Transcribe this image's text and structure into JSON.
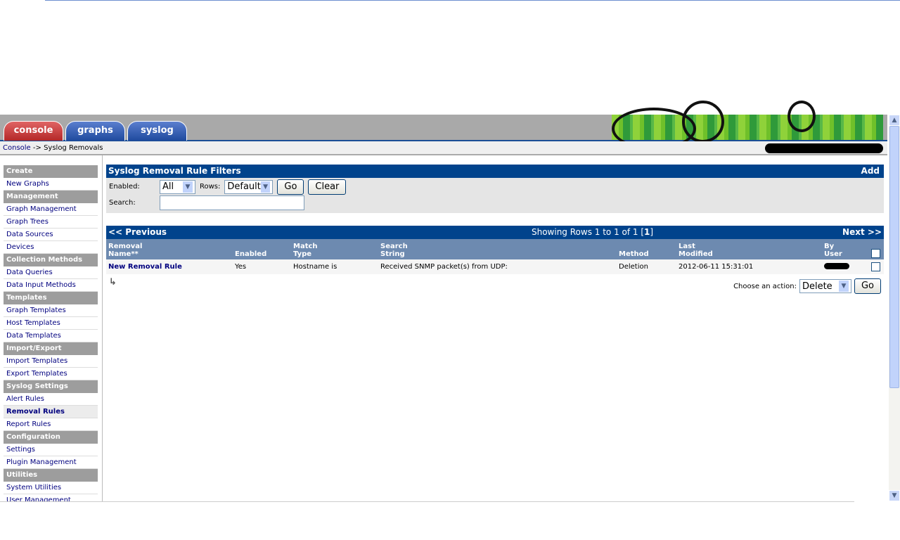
{
  "tabs": [
    {
      "label": "console"
    },
    {
      "label": "graphs"
    },
    {
      "label": "syslog"
    }
  ],
  "breadcrumb": {
    "link": "Console",
    "sep": " -> ",
    "current": "Syslog Removals"
  },
  "sidebar": [
    {
      "type": "header",
      "label": "Create"
    },
    {
      "type": "item",
      "label": "New Graphs"
    },
    {
      "type": "header",
      "label": "Management"
    },
    {
      "type": "item",
      "label": "Graph Management"
    },
    {
      "type": "item",
      "label": "Graph Trees"
    },
    {
      "type": "item",
      "label": "Data Sources"
    },
    {
      "type": "item",
      "label": "Devices"
    },
    {
      "type": "header",
      "label": "Collection Methods"
    },
    {
      "type": "item",
      "label": "Data Queries"
    },
    {
      "type": "item",
      "label": "Data Input Methods"
    },
    {
      "type": "header",
      "label": "Templates"
    },
    {
      "type": "item",
      "label": "Graph Templates"
    },
    {
      "type": "item",
      "label": "Host Templates"
    },
    {
      "type": "item",
      "label": "Data Templates"
    },
    {
      "type": "header",
      "label": "Import/Export"
    },
    {
      "type": "item",
      "label": "Import Templates"
    },
    {
      "type": "item",
      "label": "Export Templates"
    },
    {
      "type": "header",
      "label": "Syslog Settings"
    },
    {
      "type": "item",
      "label": "Alert Rules"
    },
    {
      "type": "item",
      "label": "Removal Rules",
      "selected": true
    },
    {
      "type": "item",
      "label": "Report Rules"
    },
    {
      "type": "header",
      "label": "Configuration"
    },
    {
      "type": "item",
      "label": "Settings"
    },
    {
      "type": "item",
      "label": "Plugin Management"
    },
    {
      "type": "header",
      "label": "Utilities"
    },
    {
      "type": "item",
      "label": "System Utilities"
    },
    {
      "type": "item",
      "label": "User Management"
    }
  ],
  "filters": {
    "title": "Syslog Removal Rule Filters",
    "add": "Add",
    "enabled_label": "Enabled:",
    "enabled_value": "All",
    "rows_label": "Rows:",
    "rows_value": "Default",
    "go": "Go",
    "clear": "Clear",
    "search_label": "Search:",
    "search_value": ""
  },
  "nav": {
    "previous": "<< Previous",
    "showing": "Showing Rows 1 to 1 of 1 [",
    "page": "1",
    "showing_end": "]",
    "next": "Next >>"
  },
  "table": {
    "columns": [
      [
        "Removal",
        "Name**"
      ],
      [
        "",
        "Enabled"
      ],
      [
        "Match",
        "Type"
      ],
      [
        "Search",
        "String"
      ],
      [
        "",
        "Method"
      ],
      [
        "Last",
        "Modified"
      ],
      [
        "By",
        "User"
      ]
    ],
    "rows": [
      [
        "New Removal Rule",
        "Yes",
        "Hostname is",
        "Received SNMP packet(s) from UDP:",
        "Deletion",
        "2012-06-11 15:31:01",
        ""
      ]
    ]
  },
  "actions": {
    "label": "Choose an action:",
    "value": "Delete",
    "go": "Go"
  },
  "icons": {
    "arrow": "corner-arrow-icon",
    "scroll_up": "chevron-up-icon",
    "scroll_down": "chevron-down-icon"
  }
}
